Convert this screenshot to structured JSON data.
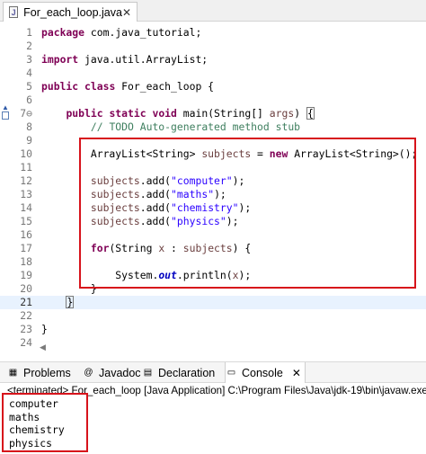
{
  "editor_tab": {
    "title": "For_each_loop.java",
    "close": "✕",
    "icon": "J"
  },
  "lines": [
    {
      "n": "1",
      "html": "<span class=\"kw\">package</span> com.java_tutorial;"
    },
    {
      "n": "2",
      "html": ""
    },
    {
      "n": "3",
      "html": "<span class=\"kw\">import</span> java.util.ArrayList;"
    },
    {
      "n": "4",
      "html": ""
    },
    {
      "n": "5",
      "html": "<span class=\"kw\">public</span> <span class=\"kw\">class</span> For_each_loop {"
    },
    {
      "n": "6",
      "html": ""
    },
    {
      "n": "7⊖",
      "html": "    <span class=\"kw\">public</span> <span class=\"kw\">static</span> <span class=\"kw\">void</span> main(String[] <span class=\"prm\">args</span>) <span class=\"bracket-box\">{</span>"
    },
    {
      "n": "8",
      "html": "        <span class=\"cmt\">// TODO Auto-generated method stub</span>"
    },
    {
      "n": "9",
      "html": ""
    },
    {
      "n": "10",
      "html": "        ArrayList&lt;String&gt; <span class=\"prm\">subjects</span> = <span class=\"kw\">new</span> ArrayList&lt;String&gt;();"
    },
    {
      "n": "11",
      "html": ""
    },
    {
      "n": "12",
      "html": "        <span class=\"prm\">subjects</span>.add(<span class=\"str\">\"computer\"</span>);"
    },
    {
      "n": "13",
      "html": "        <span class=\"prm\">subjects</span>.add(<span class=\"str\">\"maths\"</span>);"
    },
    {
      "n": "14",
      "html": "        <span class=\"prm\">subjects</span>.add(<span class=\"str\">\"chemistry\"</span>);"
    },
    {
      "n": "15",
      "html": "        <span class=\"prm\">subjects</span>.add(<span class=\"str\">\"physics\"</span>);"
    },
    {
      "n": "16",
      "html": ""
    },
    {
      "n": "17",
      "html": "        <span class=\"kw\">for</span>(String <span class=\"prm\">x</span> : <span class=\"prm\">subjects</span>) {"
    },
    {
      "n": "18",
      "html": ""
    },
    {
      "n": "19",
      "html": "            System.<span class=\"fld\">out</span>.println(<span class=\"prm\">x</span>);"
    },
    {
      "n": "20",
      "html": "        }"
    },
    {
      "n": "21",
      "html": "    <span class=\"bracket-box\">}</span>"
    },
    {
      "n": "22",
      "html": ""
    },
    {
      "n": "23",
      "html": "}"
    },
    {
      "n": "24",
      "html": ""
    }
  ],
  "current_line": "21",
  "views_tabs": [
    {
      "label": "Problems",
      "icon": "▦",
      "name": "tab-problems",
      "active": false
    },
    {
      "label": "Javadoc",
      "icon": "@",
      "name": "tab-javadoc",
      "active": false
    },
    {
      "label": "Declaration",
      "icon": "▤",
      "name": "tab-declaration",
      "active": false
    },
    {
      "label": "Console",
      "icon": "▭",
      "name": "tab-console",
      "active": true,
      "close": "✕"
    }
  ],
  "console": {
    "status": "<terminated> For_each_loop [Java Application] C:\\Program Files\\Java\\jdk-19\\bin\\javaw.exe",
    "output": [
      "computer",
      "maths",
      "chemistry",
      "physics"
    ]
  },
  "colors": {
    "highlight_box": "#d7131b",
    "keyword": "#7f0055",
    "string": "#2a00ff",
    "comment": "#3f7f5f"
  }
}
